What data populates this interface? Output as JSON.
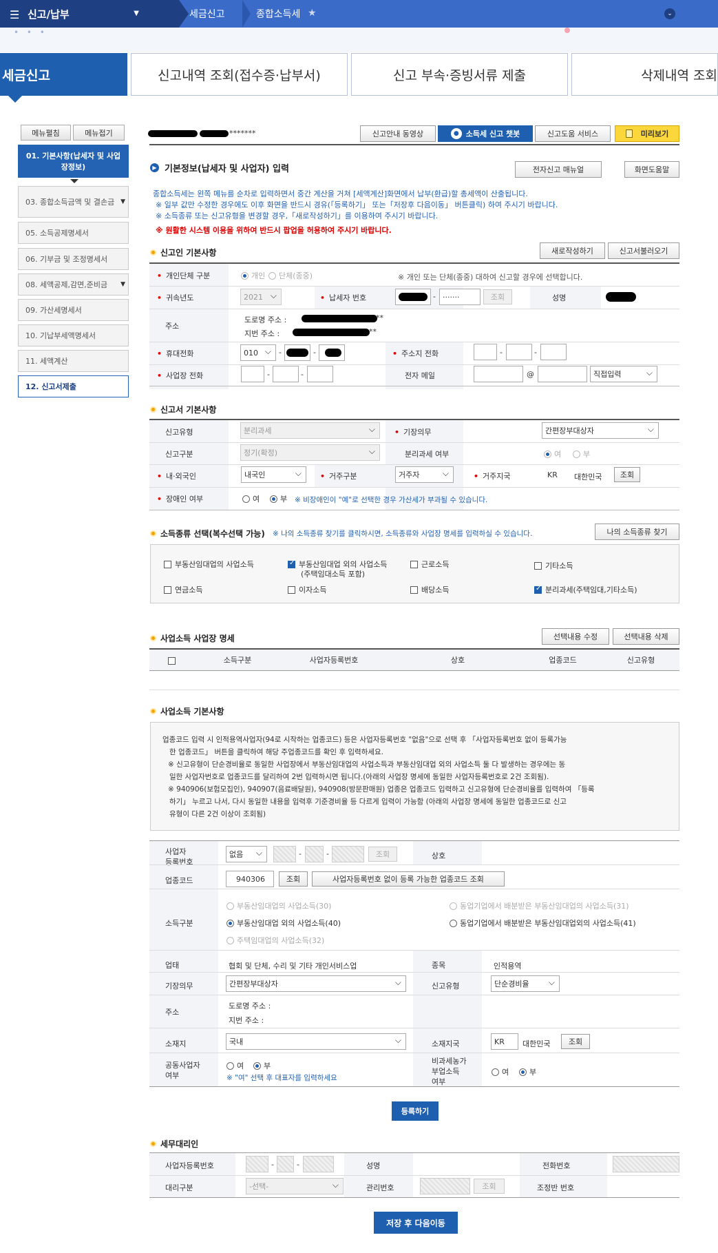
{
  "topnav": {
    "menu_label": "신고/납부",
    "crumb1": "세금신고",
    "crumb2": "종합소득세"
  },
  "tabs": {
    "t1": "세금신고",
    "t2": "신고내역 조회(접수증·납부서)",
    "t3": "신고 부속·증빙서류 제출",
    "t4": "삭제내역 조회"
  },
  "sidebar": {
    "edit": "메뉴펼침",
    "collapse": "메뉴접기",
    "items": [
      "01. 기본사항(납세자 및 사업장정보)",
      "03. 종합소득금액 및 결손금",
      "05. 소득공제명세서",
      "06. 기부금 및 조정명세서",
      "08. 세액공제,감면,준비금",
      "09. 가산세명세서",
      "10. 기납부세액명세서",
      "11. 세액계산",
      "12. 신고서제출"
    ]
  },
  "header": {
    "user_mask": "*******",
    "btn_video": "신고안내 동영상",
    "btn_chatbot": "소득세 신고 챗봇",
    "btn_help": "신고도움 서비스",
    "btn_preview": "미리보기",
    "section_title": "기본정보(납세자 및 사업자) 입력",
    "btn_manual": "전자신고 매뉴얼",
    "btn_screenhelp": "화면도움말",
    "info1": "종합소득세는 왼쪽 메뉴를 순차로 입력하면서 중간 계산을 거쳐 [세액계산]화면에서 납부(환급)할 총세액이 산출됩니다.",
    "info2": "※ 일부 값만 수정한 경우에도 이후 화면을 반드시 경유(「등록하기」 또는「저장후 다음이동」 버튼클릭) 하여 주시기 바랍니다.",
    "info3": "※ 소득종류 또는 신고유형을 변경할 경우,「새로작성하기」를 이용하여 주시기 바랍니다.",
    "warn": "※ 원활한 시스템 이용을 위하여 반드시 팝업을 허용하여 주시기 바랍니다."
  },
  "reporter": {
    "title": "신고인 기본사항",
    "btn_new": "새로작성하기",
    "btn_load": "신고서불러오기",
    "type_label": "개인단체 구분",
    "opt_individual": "개인",
    "opt_group": "단체(종중)",
    "type_note": "※ 개인 또는 단체(종중) 대하여 신고할 경우에 선택합니다.",
    "year_label": "귀속년도",
    "year_value": "2021",
    "taxpayer_no_label": "납세자 번호",
    "taxpayer_no_mask": "·······",
    "btn_lookup": "조회",
    "name_label": "성명",
    "address_label": "주소",
    "road_addr": "도로명 주소 :",
    "lot_addr": "지번 주소 :",
    "mask_tail": "**",
    "mobile_label": "휴대전화",
    "mobile_prefix": "010",
    "home_phone_label": "주소지 전화",
    "biz_phone_label": "사업장 전화",
    "email_label": "전자 메일",
    "email_at": "@",
    "email_domain": "직접입력",
    "dash": "-"
  },
  "report_basic": {
    "title": "신고서 기본사항",
    "report_type_label": "신고유형",
    "report_type_value": "분리과세",
    "bookkeeping_label": "기장의무",
    "bookkeeping_value": "간편장부대상자",
    "report_class_label": "신고구분",
    "report_class_value": "정기(확정)",
    "separate_tax_label": "분리과세 여부",
    "yes": "여",
    "no": "부",
    "nationality_label": "내·외국인",
    "nationality_value": "내국인",
    "residence_label": "거주구분",
    "residence_value": "거주자",
    "region_label": "거주지국",
    "region_code": "KR",
    "region_name": "대한민국",
    "btn_lookup": "조회",
    "disabled_label": "장애인 여부",
    "disabled_note": "※ 비장애인이 \"예\"로 선택한 경우 가산세가 부과될 수 있습니다."
  },
  "income_kind": {
    "title": "소득종류 선택(복수선택 가능)",
    "note": "※ 나의 소득종류 찾기를 클릭하시면, 소득종류와 사업장 명세를 입력하실 수 있습니다.",
    "btn_find": "나의 소득종류 찾기",
    "c1": "부동산임대업의 사업소득",
    "c2": "부동산임대업 외의 사업소득",
    "c2b": "(주택임대소득 포함)",
    "c3": "근로소득",
    "c4": "기타소득",
    "c5": "연금소득",
    "c6": "이자소득",
    "c7": "배당소득",
    "c8": "분리과세(주택임대,기타소득)"
  },
  "biz_list": {
    "title": "사업소득 사업장 명세",
    "btn_edit": "선택내용 수정",
    "btn_delete": "선택내용 삭제",
    "columns": [
      "소득구분",
      "사업자등록번호",
      "상호",
      "업종코드",
      "신고유형"
    ]
  },
  "biz_basic": {
    "title": "사업소득 기본사항",
    "notice1": "업종코드 입력 시 인적용역사업자(94로 시작하는 업종코드) 등은 사업자등록번호 \"없음\"으로 선택 후 「사업자등록번호 없이 등록가능",
    "notice1b": "한 업종코드」 버튼을 클릭하여 해당 주업종코드를 확인 후 입력하세요.",
    "notice2": "※ 신고유형이 단순경비율로 동일한 사업장에서 부동산임대업의 사업소득과 부동산임대업 외의 사업소득 둘 다 발생하는 경우에는 동",
    "notice2b": "일한 사업자번호로 업종코드를 달리하여 2번 입력하시면 됩니다.(아래의 사업장 명세에 동일한 사업자등록번호로 2건 조회됨).",
    "notice3": "※ 940906(보험모집인), 940907(음료배달원), 940908(방문판매원) 업종은 업종코드 입력하고 신고유형에 단순경비율를 입력하여 「등록",
    "notice3b": "하기」 누르고 나서, 다시 동일한 내용을 입력후 기준경비율 등 다르게 입력이 가능함 (아래의 사업장 명세에 동일한 업종코드로 신고",
    "notice3c": "유형이 다른 2건 이상이 조회됨)",
    "bizno_label1": "사업자",
    "bizno_label2": "등록번호",
    "bizno_sel": "없음",
    "btn_lookup": "조회",
    "trade_name_label": "상호",
    "industry_label": "업종코드",
    "industry_value": "940306",
    "btn_noreg": "사업자등록번호 없이 등록 가능한 업종코드 조회",
    "income_class_label": "소득구분",
    "r1": "부동산임대업의 사업소득(30)",
    "r2": "부동산임대업 외의 사업소득(40)",
    "r3": "주택임대업의 사업소득(32)",
    "r4": "동업기업에서 배분받은 부동산임대업의 사업소득(31)",
    "r5": "동업기업에서 배분받은 부동산임대업외의 사업소득(41)",
    "business_label": "업태",
    "business_value": "협회 및 단체, 수리 및 기타 개인서비스업",
    "item_label": "종목",
    "item_value": "인적용역",
    "bookkeeping_label": "기장의무",
    "bookkeeping_value": "간편장부대상자",
    "report_type_label": "신고유형",
    "report_type_value": "단순경비율",
    "address_label": "주소",
    "road_addr": "도로명 주소 :",
    "lot_addr": "지번 주소 :",
    "location_label": "소재지",
    "location_value": "국내",
    "loc_region_label": "소재지국",
    "loc_code": "KR",
    "loc_name": "대한민국",
    "joint_label1": "공동사업자",
    "joint_label2": "여부",
    "joint_note": "※ \"여\" 선택 후 대표자를 입력하세요",
    "farm_label1": "비과세농가",
    "farm_label2": "부업소득",
    "farm_label3": "여부",
    "yes": "여",
    "no": "부",
    "btn_register": "등록하기"
  },
  "agent": {
    "title": "세무대리인",
    "bizno_label": "사업자등록번호",
    "name_label": "성명",
    "phone_label": "전화번호",
    "class_label": "대리구분",
    "class_value": "-선택-",
    "mgmt_label": "관리번호",
    "btn_lookup": "조회",
    "adjust_label": "조정반 번호"
  },
  "footer": {
    "btn_save_next": "저장 후 다음이동"
  }
}
